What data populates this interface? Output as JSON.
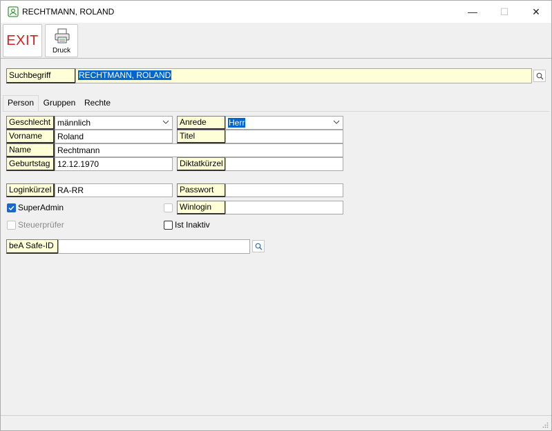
{
  "window": {
    "title": "RECHTMANN, ROLAND"
  },
  "titlebar": {
    "minimize": "—",
    "maximize": "☐",
    "close": "✕"
  },
  "toolbar": {
    "exit_label": "EXIT",
    "print_label": "Druck"
  },
  "search": {
    "label": "Suchbegriff",
    "value": "RECHTMANN, ROLAND"
  },
  "tabs": [
    {
      "label": "Person"
    },
    {
      "label": "Gruppen"
    },
    {
      "label": "Rechte"
    }
  ],
  "form": {
    "geschlecht": {
      "label": "Geschlecht",
      "value": "männlich"
    },
    "anrede": {
      "label": "Anrede",
      "value": "Herr"
    },
    "vorname": {
      "label": "Vorname",
      "value": "Roland"
    },
    "titel": {
      "label": "Titel",
      "value": ""
    },
    "name": {
      "label": "Name",
      "value": "Rechtmann"
    },
    "geburtstag": {
      "label": "Geburtstag",
      "value": "12.12.1970"
    },
    "diktatkuerzel": {
      "label": "Diktatkürzel",
      "value": ""
    },
    "loginkuerzel": {
      "label": "Loginkürzel",
      "value": "RA-RR"
    },
    "passwort": {
      "label": "Passwort",
      "value": ""
    },
    "winlogin": {
      "label": "Winlogin",
      "value": ""
    },
    "bea_safe_id": {
      "label": "beA Safe-ID",
      "value": ""
    }
  },
  "checkboxes": {
    "superadmin": {
      "label": "SuperAdmin",
      "checked": true
    },
    "steuerpruefer": {
      "label": "Steuerprüfer",
      "checked": false,
      "disabled": true
    },
    "winlogin_enabled": {
      "checked": false,
      "disabled": true
    },
    "ist_inaktiv": {
      "label": "Ist Inaktiv",
      "checked": false
    }
  },
  "colors": {
    "label_bg": "#ffffd7",
    "selection": "#0066cc",
    "exit_red": "#d02020"
  }
}
